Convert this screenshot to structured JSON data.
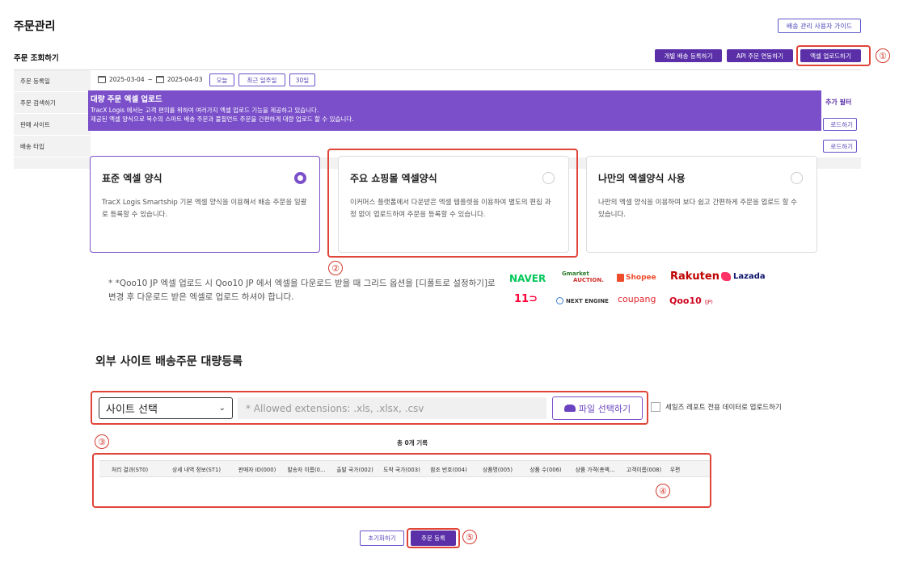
{
  "page": {
    "title": "주문관리",
    "guide_button": "배송 관리 사용자 가이드"
  },
  "section": {
    "title": "주문 조회하기"
  },
  "toolbar": {
    "individual": "개별 배송 등록하기",
    "api": "API 주문 연동하기",
    "excel": "엑셀 업로드하기"
  },
  "search": {
    "labels": [
      "주문 등록일",
      "주문 검색하기",
      "판매 사이트",
      "배송 타입"
    ],
    "date_from": "2025-03-04",
    "date_sep": "~",
    "date_to": "2025-04-03",
    "chips": [
      "오늘",
      "최근 일주일",
      "30일"
    ],
    "add_filter": "추가 필터",
    "side_btn_1": "로드하기",
    "side_btn_2": "로드하기"
  },
  "banner": {
    "title": "대량 주문 엑셀 업로드",
    "line1": "TracX Logis 에서는 고객 편의를 위하여 여러가지 엑셀 업로드 기능을 제공하고 있습니다.",
    "line2": "제공된 엑셀 양식으로 복수의 스마트 배송 주문과 풀필먼트 주문을 간편하게 대량 업로드 할 수 있습니다."
  },
  "cards": [
    {
      "title": "표준 엑셀 양식",
      "desc": "TracX Logis Smartship 기본 엑셀 양식을 이용해서 배송 주문을 일괄로 등록할 수 있습니다.",
      "selected": true
    },
    {
      "title": "주요 쇼핑몰 엑셀양식",
      "desc": "이커머스 플랫폼에서 다운받은 엑셀 템플렛을 이용하여 별도의 편집 과정 없이 업로드하여 주문을 등록할 수 있습니다.",
      "selected": false
    },
    {
      "title": "나만의 엑셀양식 사용",
      "desc": "나만의 엑셀 양식을 이용하여 보다 쉽고 간편하게 주문을 업로드 할 수 있습니다.",
      "selected": false
    }
  ],
  "notice": "* *Qoo10 JP 엑셀 업로드 시 Qoo10 JP 에서 엑셀을 다운로드 받을 때 그리드 옵션을 [디폴트로 설정하기]로 변경 후 다운로드 받은 엑셀로 업로드 하셔야 합니다.",
  "logos": {
    "naver": "NAVER",
    "gmarket_top": "Gmarket",
    "gmarket_bottom": "AUCTION.",
    "shopee": "Shopee",
    "rakuten": "Rakuten",
    "lazada": "Lazada",
    "eleven": "11",
    "next_engine": "NEXT ENGINE",
    "coupang": "coupang",
    "qoo10": "Qoo10",
    "qoo10_suffix": "(JP)"
  },
  "register": {
    "title": "외부 사이트 배송주문 대량등록",
    "site_select": "사이트 선택",
    "file_placeholder": "* Allowed extensions: .xls, .xlsx, .csv",
    "file_button": "파일 선택하기",
    "checkbox_label": "세일즈 레포트 전용 데이터로 업로드하기",
    "total": "총 0개 기록"
  },
  "grid": {
    "columns": [
      "처리 결과(ST0)",
      "상세 내역 정보(ST1)",
      "판매자 ID(000)",
      "발송자 이름(0...",
      "출발 국가(002)",
      "도착 국가(003)",
      "참조 번호(004)",
      "상품명(005)",
      "상품 수(006)",
      "상품 가격(총액...",
      "고객이름(008)",
      "우편"
    ]
  },
  "actions": {
    "reset": "초기화하기",
    "submit": "주문 등록"
  },
  "markers": [
    "①",
    "②",
    "③",
    "④",
    "⑤"
  ],
  "colors": {
    "accent": "#5a2fa8",
    "banner": "#7a4fc9",
    "highlight": "#e0453a"
  }
}
